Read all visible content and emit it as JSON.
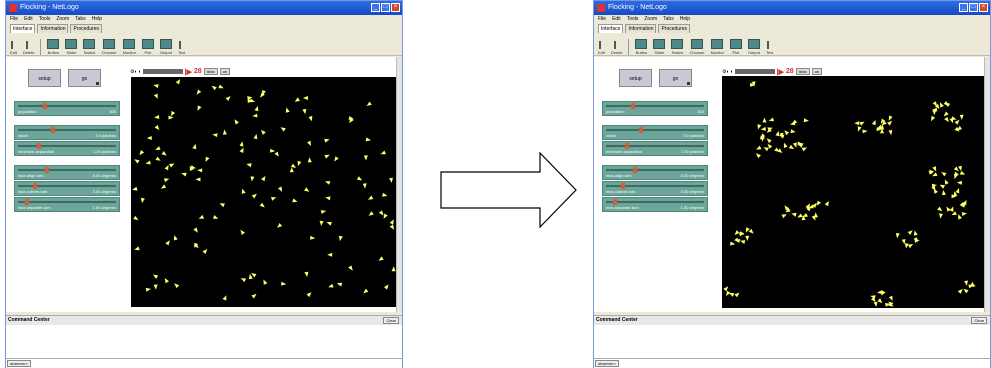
{
  "windows": [
    {
      "id": "before",
      "title": "Flocking - NetLogo",
      "menu": [
        "File",
        "Edit",
        "Tools",
        "Zoom",
        "Tabs",
        "Help"
      ],
      "tabs": [
        "Interface",
        "Information",
        "Procedures"
      ],
      "toolbar": [
        "Edit",
        "Delete",
        "Button",
        "Slider",
        "Switch",
        "Chooser",
        "Monitor",
        "Plot",
        "Output",
        "Text"
      ],
      "buttons": {
        "setup": "setup",
        "go": "go"
      },
      "sliders": [
        {
          "label": "population",
          "value": "300"
        },
        {
          "label": "vision",
          "value": "3.0 patches"
        },
        {
          "label": "minimum-separation",
          "value": "1.00 patches"
        },
        {
          "label": "max-align-turn",
          "value": "5.00 degrees"
        },
        {
          "label": "max-cohere-turn",
          "value": "3.00 degrees"
        },
        {
          "label": "max-separate-turn",
          "value": "1.50 degrees"
        }
      ],
      "view_speed": "28",
      "command_center": "Command Center",
      "clear_label": "Clear",
      "observer_label": "observer>",
      "distribution": "scattered"
    },
    {
      "id": "after",
      "title": "Flocking - NetLogo",
      "menu": [
        "File",
        "Edit",
        "Tools",
        "Zoom",
        "Tabs",
        "Help"
      ],
      "tabs": [
        "Interface",
        "Information",
        "Procedures"
      ],
      "toolbar": [
        "Edit",
        "Delete",
        "Button",
        "Slider",
        "Switch",
        "Chooser",
        "Monitor",
        "Plot",
        "Output",
        "Text"
      ],
      "buttons": {
        "setup": "setup",
        "go": "go"
      },
      "sliders": [
        {
          "label": "population",
          "value": "300"
        },
        {
          "label": "vision",
          "value": "3.0 patches"
        },
        {
          "label": "minimum-separation",
          "value": "1.00 patches"
        },
        {
          "label": "max-align-turn",
          "value": "5.00 degrees"
        },
        {
          "label": "max-cohere-turn",
          "value": "3.00 degrees"
        },
        {
          "label": "max-separate-turn",
          "value": "1.50 degrees"
        }
      ],
      "view_speed": "28",
      "command_center": "Command Center",
      "clear_label": "Clear",
      "observer_label": "observer>",
      "distribution": "flocked"
    }
  ],
  "colors": {
    "bird": "#ffff66",
    "slider": "#6ca59a",
    "world": "#000000",
    "titlebar": "#1f5ad6"
  }
}
